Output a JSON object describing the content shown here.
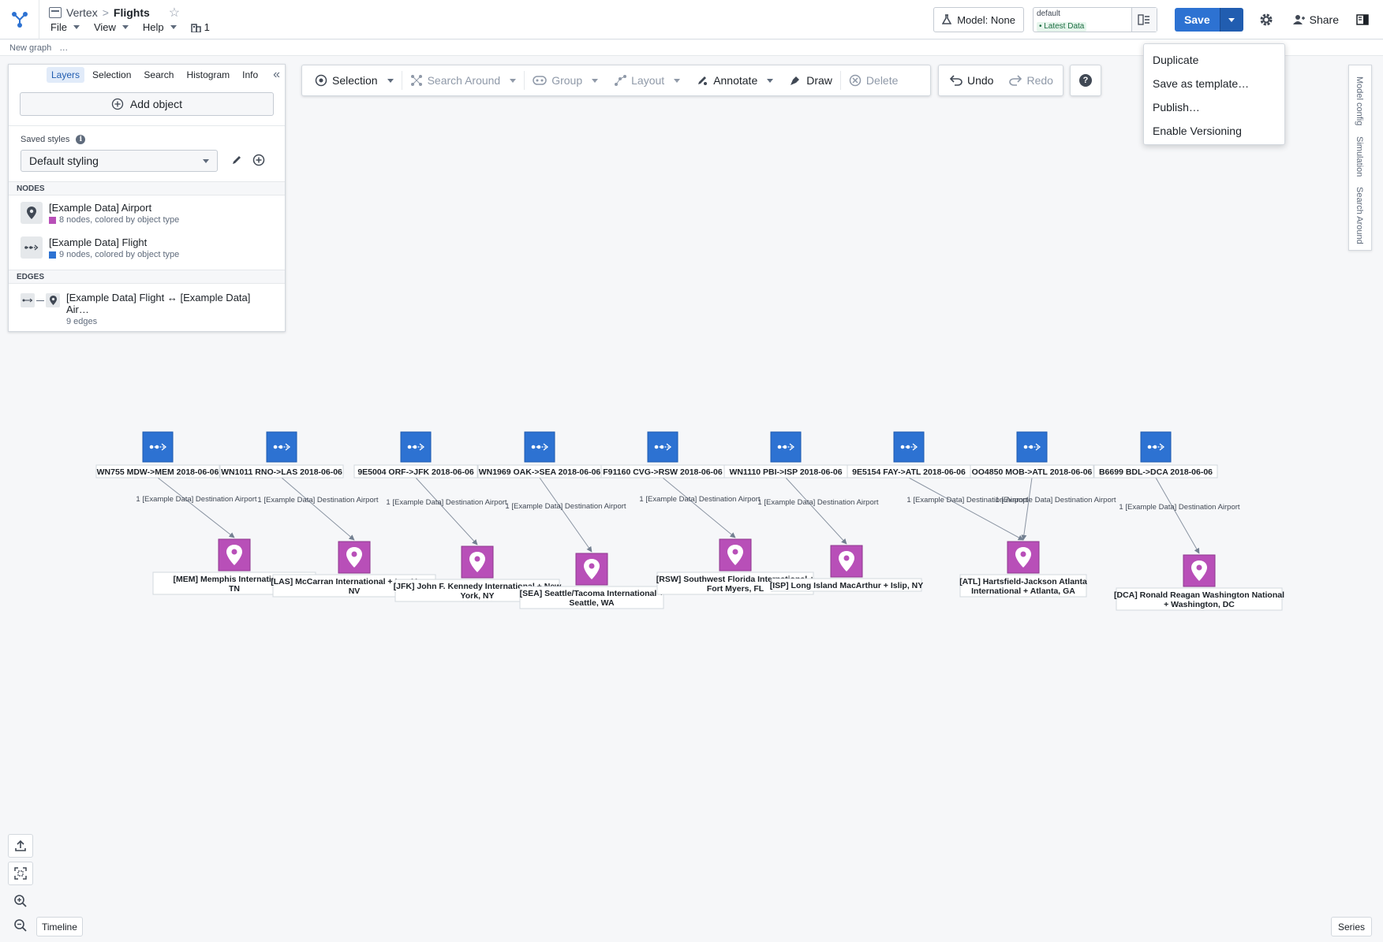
{
  "header": {
    "app_name": "Vertex",
    "breadcrumb_sep": ">",
    "title": "Flights",
    "menus": [
      "File",
      "View",
      "Help"
    ],
    "count": "1",
    "model_label": "Model: None",
    "branch_name": "default",
    "branch_tag": "• Latest Data",
    "save_label": "Save",
    "share_label": "Share"
  },
  "subheader": {
    "label": "New graph",
    "ellipsis": "…"
  },
  "left_panel": {
    "tabs": [
      "Layers",
      "Selection",
      "Search",
      "Histogram",
      "Info"
    ],
    "active_tab": "Layers",
    "add_object": "Add object",
    "saved_styles_label": "Saved styles",
    "saved_style_value": "Default styling",
    "nodes_header": "NODES",
    "nodes": [
      {
        "title": "[Example Data] Airport",
        "subtitle": "8 nodes, colored by object type",
        "color": "#b84fb8",
        "icon": "map-pin-icon"
      },
      {
        "title": "[Example Data] Flight",
        "subtitle": "9 nodes, colored by object type",
        "color": "#2d72d2",
        "icon": "flight-icon"
      }
    ],
    "edges_header": "EDGES",
    "edges": [
      {
        "title": "[Example Data] Flight ↔ [Example Data] Air…",
        "subtitle": "9 edges"
      }
    ]
  },
  "toolbar": {
    "selection": "Selection",
    "search_around": "Search Around",
    "group": "Group",
    "layout": "Layout",
    "annotate": "Annotate",
    "draw": "Draw",
    "delete": "Delete",
    "undo": "Undo",
    "redo": "Redo",
    "help": "?"
  },
  "save_menu": [
    "Duplicate",
    "Save as template…",
    "Publish…",
    "Enable Versioning"
  ],
  "right_tabs": [
    "Model config",
    "Simulation",
    "Search Around"
  ],
  "graph": {
    "flight_color": "#2d72d2",
    "airport_color": "#b84fb8",
    "flights": [
      "WN755 MDW->MEM 2018-06-06",
      "WN1011 RNO->LAS 2018-06-06",
      "9E5004 ORF->JFK 2018-06-06",
      "WN1969 OAK->SEA 2018-06-06",
      "F91160 CVG->RSW 2018-06-06",
      "WN1110 PBI->ISP 2018-06-06",
      "9E5154 FAY->ATL 2018-06-06",
      "OO4850 MOB->ATL 2018-06-06",
      "B6699 BDL->DCA 2018-06-06"
    ],
    "airports": [
      {
        "line1": "[MEM] Memphis International +",
        "line2": "TN"
      },
      {
        "line1": "[LAS] McCarran International + Las Vegas,",
        "line2": "NV"
      },
      {
        "line1": "[JFK] John F. Kennedy International + New",
        "line2": "York, NY"
      },
      {
        "line1": "[SEA] Seattle/Tacoma International +",
        "line2": "Seattle, WA"
      },
      {
        "line1": "[RSW] Southwest Florida International +",
        "line2": "Fort Myers, FL"
      },
      {
        "line1": "[ISP] Long Island MacArthur + Islip, NY",
        "line2": ""
      },
      {
        "line1": "[ATL] Hartsfield-Jackson Atlanta",
        "line2": "International + Atlanta, GA"
      },
      {
        "line1": "[DCA] Ronald Reagan Washington National",
        "line2": "+ Washington, DC"
      }
    ],
    "edge_label": "1 [Example Data] Destination Airport"
  },
  "bottom": {
    "timeline": "Timeline",
    "series": "Series"
  }
}
